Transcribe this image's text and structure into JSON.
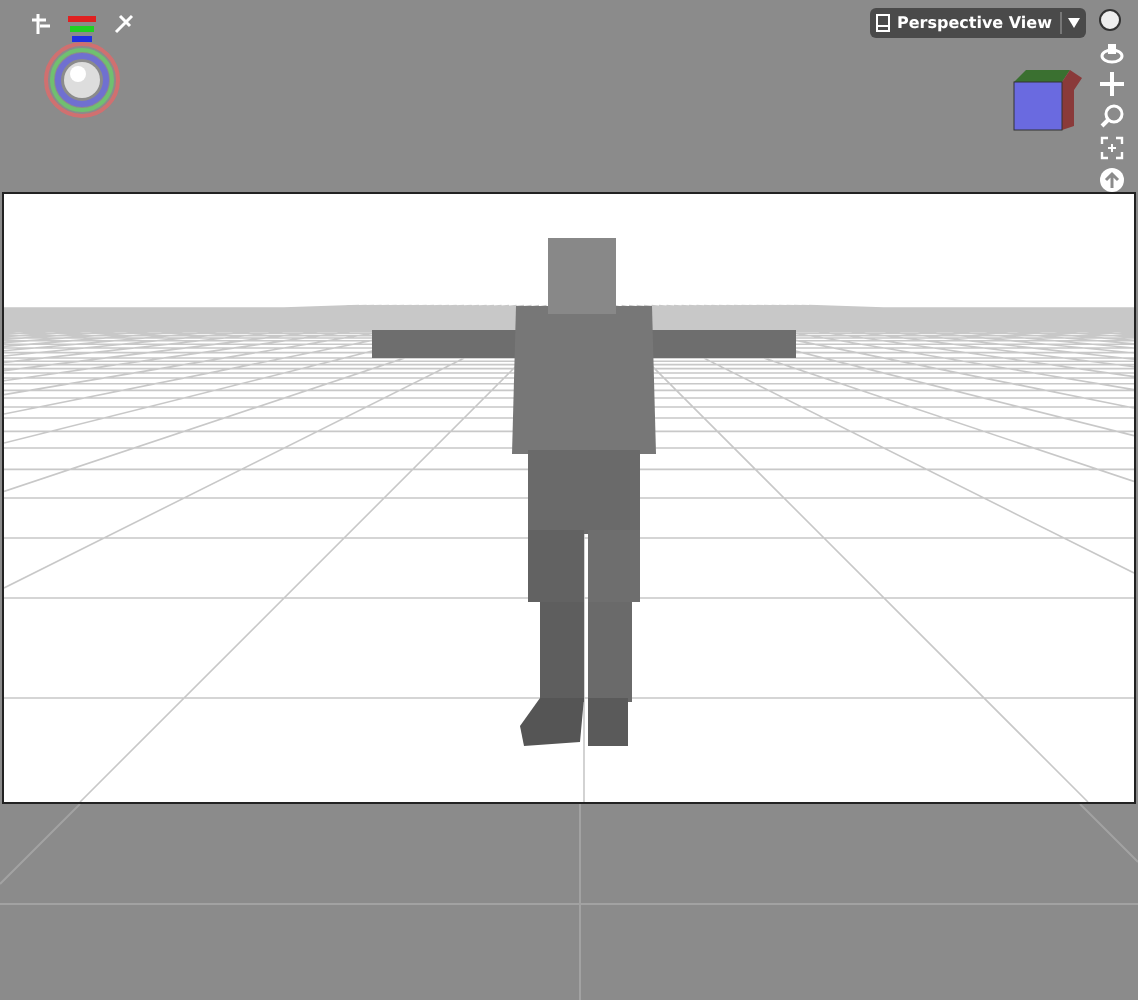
{
  "view_menu": {
    "label": "Perspective View"
  }
}
